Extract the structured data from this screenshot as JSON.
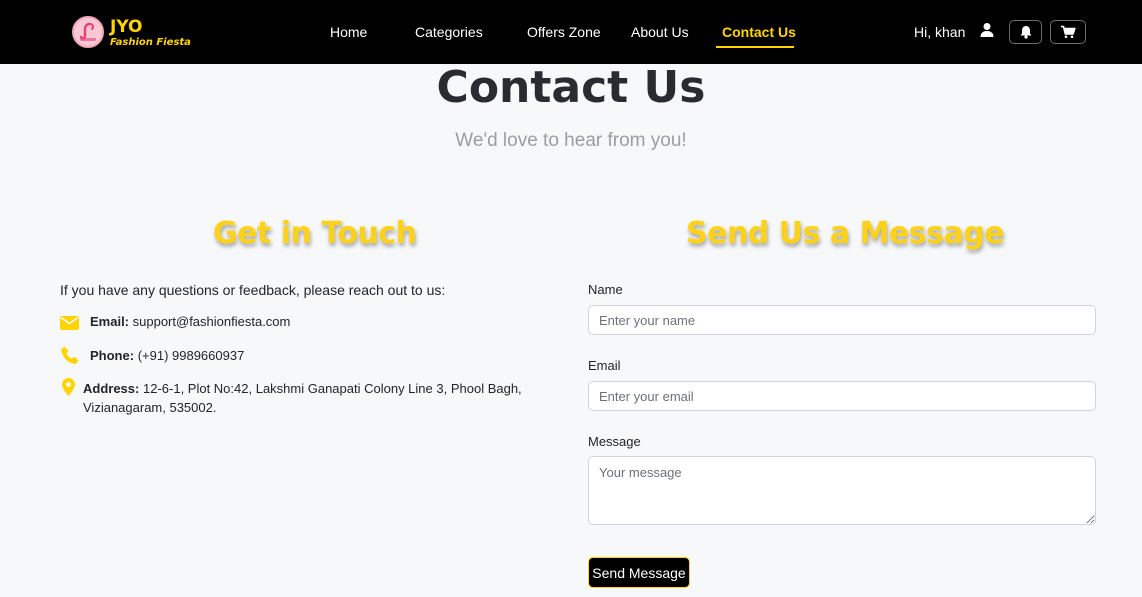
{
  "brand": {
    "name": "JYO",
    "tagline": "Fashion Fiesta"
  },
  "nav": {
    "links": [
      {
        "label": "Home"
      },
      {
        "label": "Categories"
      },
      {
        "label": "Offers Zone"
      },
      {
        "label": "About Us"
      },
      {
        "label": "Contact Us"
      }
    ],
    "active": "Contact Us",
    "greeting": "Hi, khan"
  },
  "page": {
    "title": "Contact Us",
    "subtitle": "We'd love to hear from you!"
  },
  "touch": {
    "heading": "Get in Touch",
    "intro": "If you have any questions or feedback, please reach out to us:",
    "email_label": "Email:",
    "email_value": "support@fashionfiesta.com",
    "phone_label": "Phone:",
    "phone_value": "(+91) 9989660937",
    "address_label": "Address:",
    "address_line1": "12-6-1, Plot No:42, Lakshmi Ganapati Colony Line 3, Phool Bagh,",
    "address_line2": "Vizianagaram, 535002."
  },
  "form": {
    "heading": "Send Us a Message",
    "name_label": "Name",
    "name_placeholder": "Enter your name",
    "email_label": "Email",
    "email_placeholder": "Enter your email",
    "message_label": "Message",
    "message_placeholder": "Your message",
    "submit_label": "Send Message"
  },
  "colors": {
    "accent": "#ffd400",
    "navbar": "#000000",
    "background": "#f7f8fa"
  },
  "icons": [
    "logo-icon",
    "user-icon",
    "bell-icon",
    "cart-icon",
    "envelope-icon",
    "phone-icon",
    "map-pin-icon"
  ]
}
